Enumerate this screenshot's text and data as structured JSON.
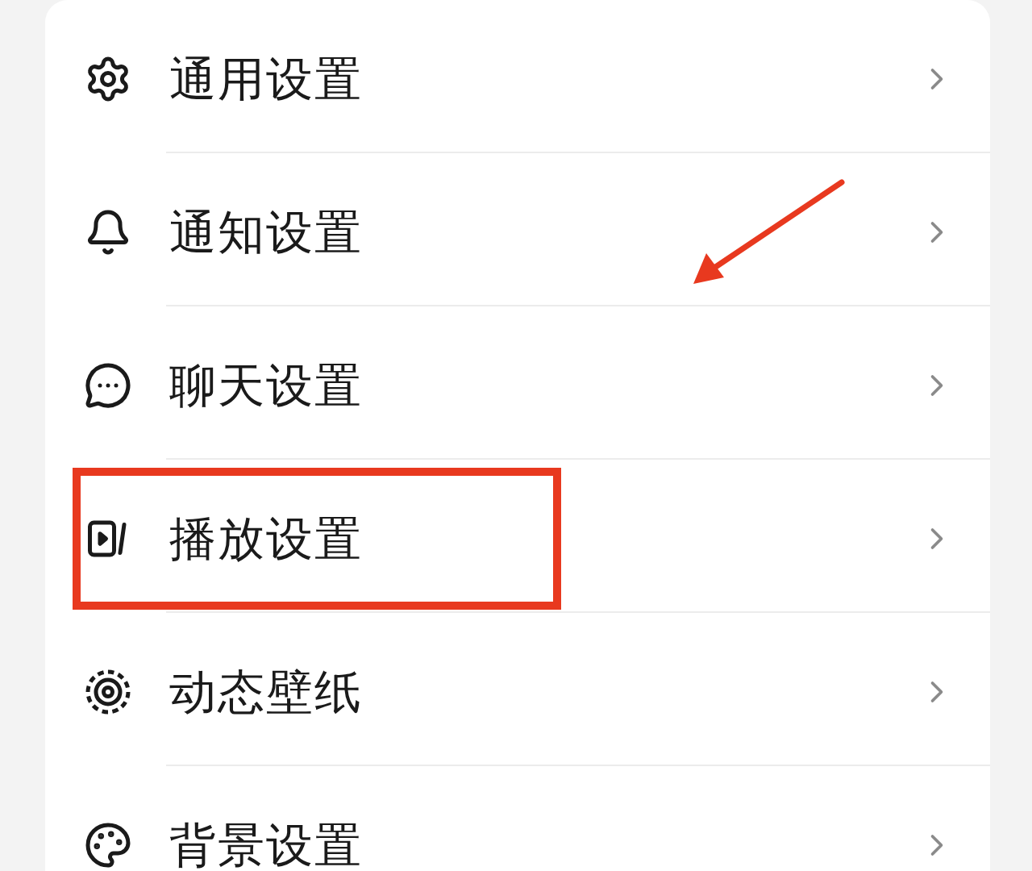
{
  "settings_items": [
    {
      "label": "通用设置",
      "highlighted": false
    },
    {
      "label": "通知设置",
      "highlighted": false
    },
    {
      "label": "聊天设置",
      "highlighted": false
    },
    {
      "label": "播放设置",
      "highlighted": true
    },
    {
      "label": "动态壁纸",
      "highlighted": false
    },
    {
      "label": "背景设置",
      "highlighted": false
    }
  ]
}
